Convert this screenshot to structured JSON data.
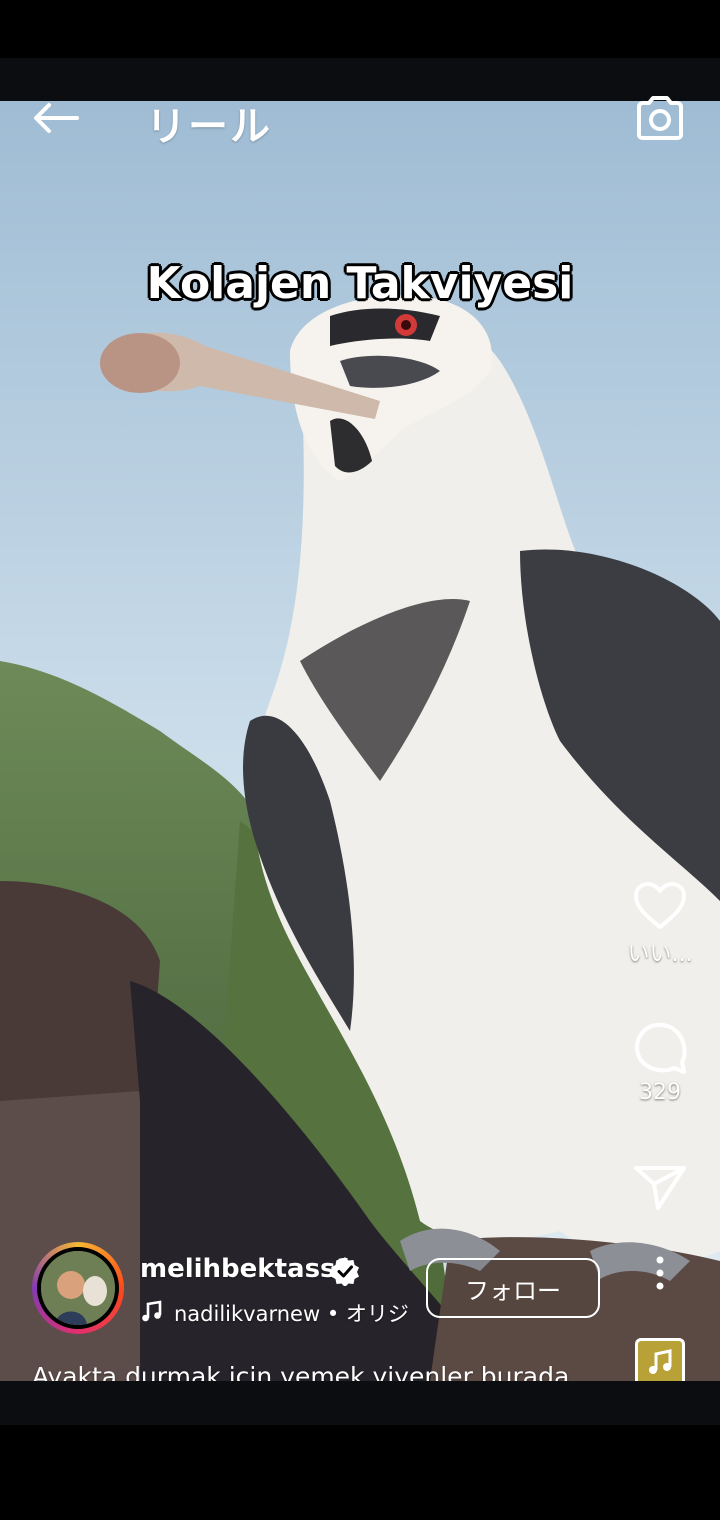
{
  "header": {
    "title": "リール",
    "back_icon": "arrow-left-icon",
    "camera_icon": "camera-icon"
  },
  "video": {
    "overlay_text": "Kolajen Takviyesi"
  },
  "actions": {
    "like_label": "いい...",
    "comment_count": "329",
    "like_icon": "heart-icon",
    "comment_icon": "comment-bubble-icon",
    "share_icon": "paper-plane-icon",
    "more_icon": "more-vertical-icon"
  },
  "author": {
    "username": "melihbektass1",
    "verified": true,
    "audio": "nadilikvarnew • オリジ",
    "follow_label": "フォロー"
  },
  "caption": "Ayakta durmak için yemek yiyenler burada ...",
  "colors": {
    "background": "#000000",
    "text": "#ffffff",
    "sky": "#a9c3d8"
  }
}
